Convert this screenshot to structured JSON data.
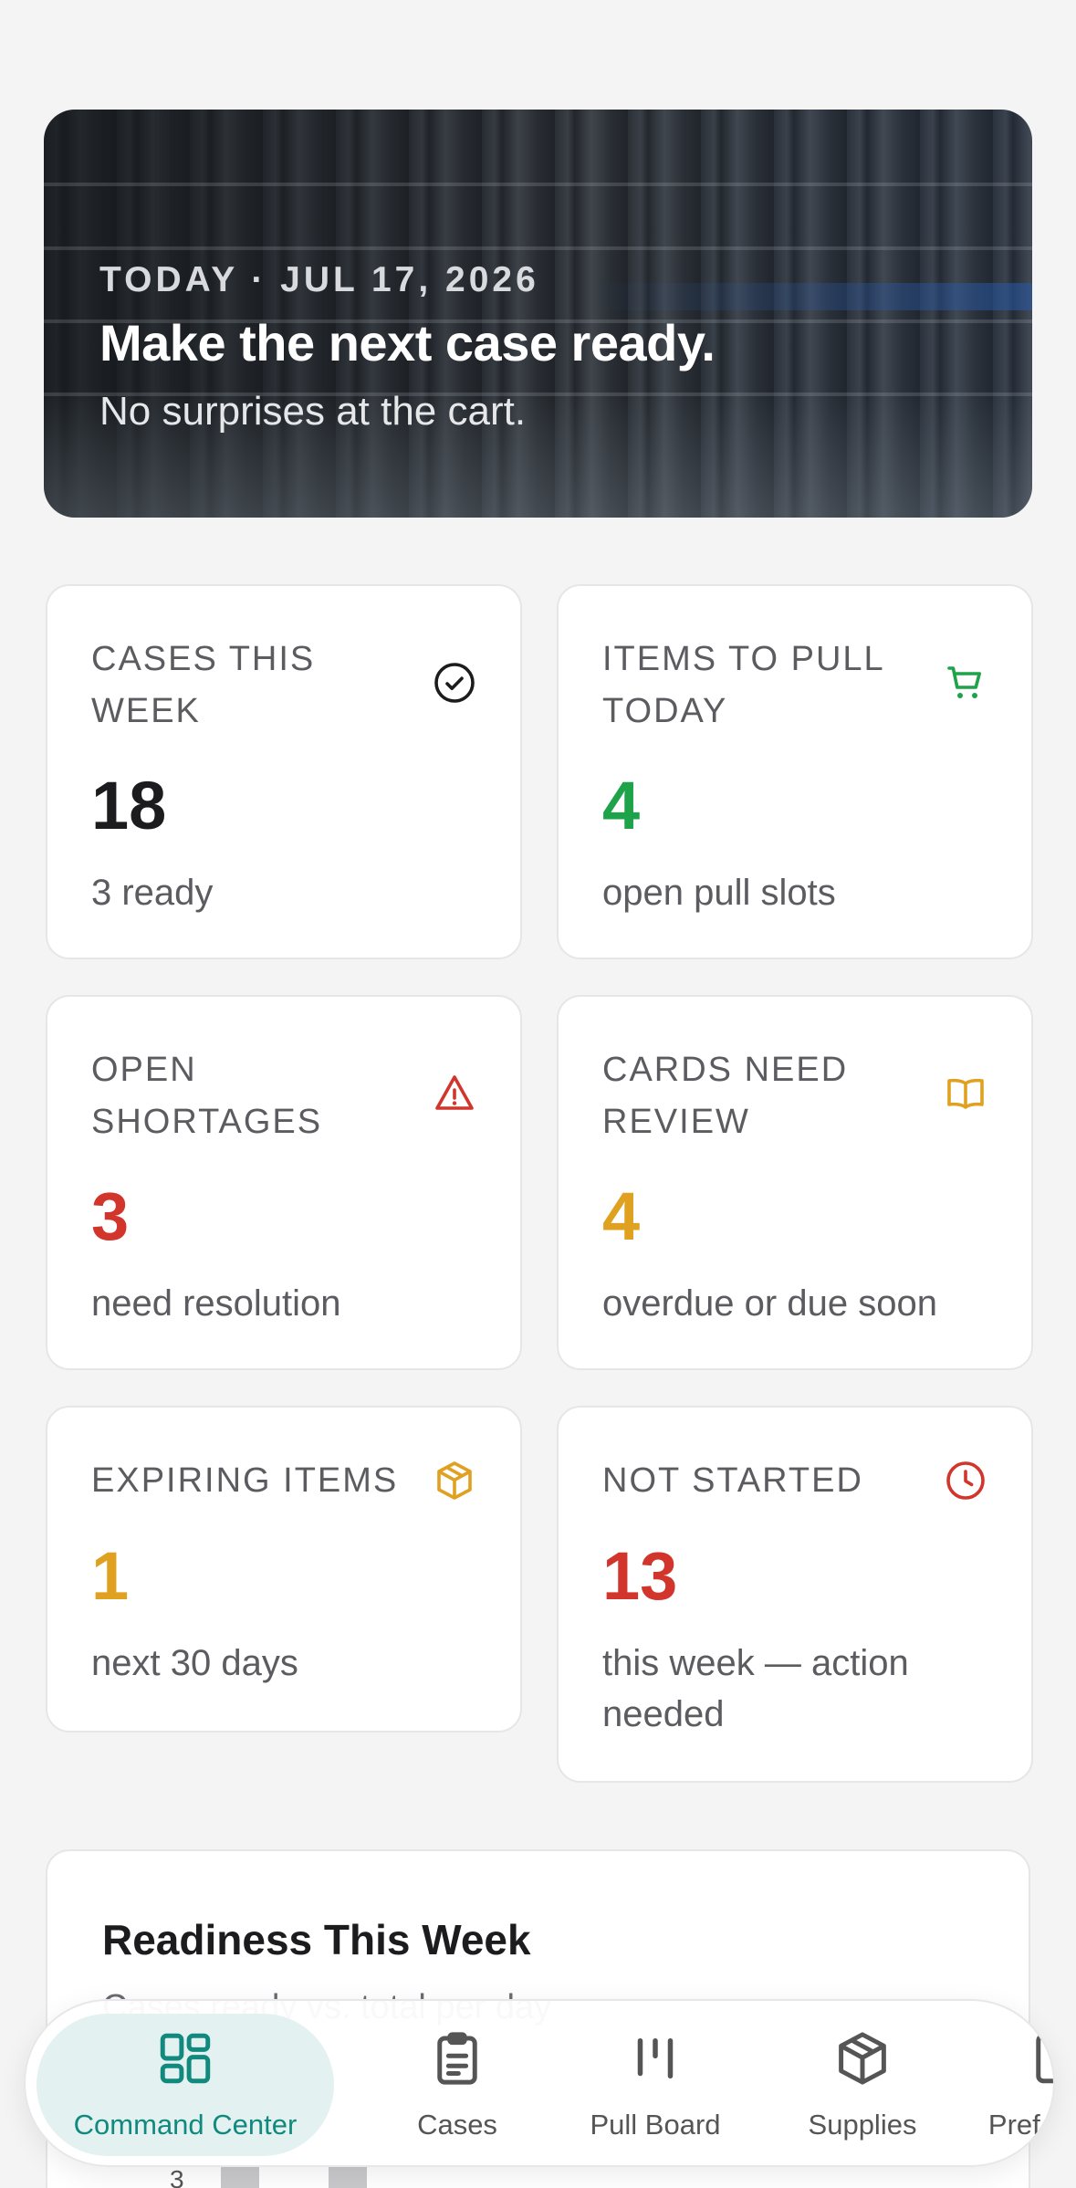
{
  "hero": {
    "date": "TODAY · JUL 17, 2026",
    "title": "Make the next case ready.",
    "subtitle": "No surprises at the cart."
  },
  "stats": [
    {
      "label": "CASES THIS WEEK",
      "value": "18",
      "sub": "3 ready",
      "icon": "check-circle-icon",
      "color": "#1c1c1e"
    },
    {
      "label": "ITEMS TO PULL TODAY",
      "value": "4",
      "sub": "open pull slots",
      "icon": "cart-icon",
      "color": "#1fa34a"
    },
    {
      "label": "OPEN SHORTAGES",
      "value": "3",
      "sub": "need resolution",
      "icon": "warning-icon",
      "color": "#d1352b"
    },
    {
      "label": "CARDS NEED REVIEW",
      "value": "4",
      "sub": "overdue or due soon",
      "icon": "book-icon",
      "color": "#e0a020"
    },
    {
      "label": "EXPIRING ITEMS",
      "value": "1",
      "sub": "next 30 days",
      "icon": "package-icon",
      "color": "#e0a020"
    },
    {
      "label": "NOT STARTED",
      "value": "13",
      "sub": "this week — action needed",
      "icon": "clock-icon",
      "color": "#d1352b"
    }
  ],
  "readiness": {
    "title": "Readiness This Week",
    "subtitle": "Cases ready vs. total per day",
    "tick": "3"
  },
  "nav": [
    {
      "label": "Command Center",
      "icon": "grid-icon",
      "active": true
    },
    {
      "label": "Cases",
      "icon": "clipboard-icon",
      "active": false
    },
    {
      "label": "Pull Board",
      "icon": "columns-icon",
      "active": false
    },
    {
      "label": "Supplies",
      "icon": "box-icon",
      "active": false
    },
    {
      "label": "Pref Cards",
      "icon": "card-icon",
      "active": false
    }
  ],
  "colors": {
    "accent": "#12897e",
    "green": "#1fa34a",
    "red": "#d1352b",
    "amber": "#e0a020"
  }
}
